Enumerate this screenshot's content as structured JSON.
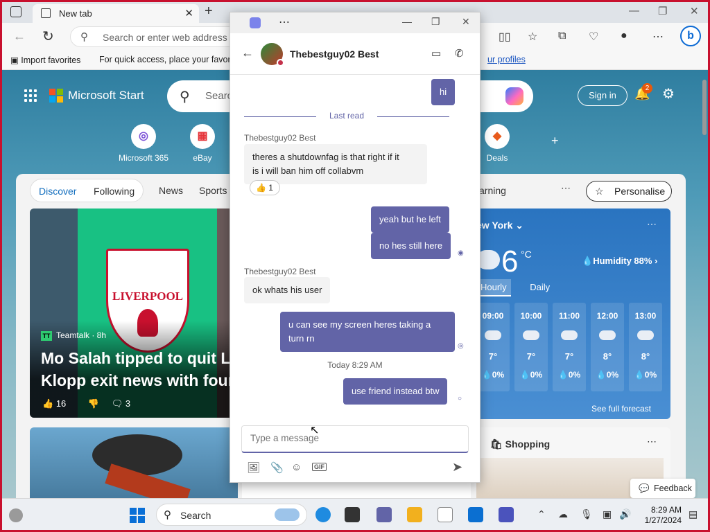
{
  "browser": {
    "tab_title": "New tab",
    "address_placeholder": "Search or enter web address",
    "favorites": {
      "import_label": "Import favorites",
      "quick_access_text": "For quick access, place your favorit",
      "profiles_link": "ur profiles"
    }
  },
  "msn": {
    "brand": "Microsoft Start",
    "search_placeholder": "Searc",
    "sign_in": "Sign in",
    "notification_count": "2",
    "quick_links": [
      {
        "label": "Microsoft 365"
      },
      {
        "label": "eBay"
      },
      {
        "label": "Deals"
      }
    ],
    "feed_tabs": [
      "Discover",
      "Following"
    ],
    "feed_nav": [
      "News",
      "Sports",
      "arning"
    ],
    "personalise": "Personalise",
    "news_card": {
      "source": "Teamtalk · 8h",
      "source_badge": "TT",
      "headline_line1": "Mo Salah tipped to quit L",
      "headline_line2": "Klopp exit news with four",
      "likes": "16",
      "comments": "3",
      "crest_text": "LIVERPOOL"
    },
    "weather": {
      "city": "ew York",
      "temp": "6",
      "unit": "°C",
      "humidity": "Humidity 88%",
      "toggle_hourly": "Hourly",
      "toggle_daily": "Daily",
      "hours": [
        {
          "time": "09:00",
          "temp": "7°",
          "precip": "0%"
        },
        {
          "time": "10:00",
          "temp": "7°",
          "precip": "0%"
        },
        {
          "time": "11:00",
          "temp": "7°",
          "precip": "0%"
        },
        {
          "time": "12:00",
          "temp": "8°",
          "precip": "0%"
        },
        {
          "time": "13:00",
          "temp": "8°",
          "precip": "0%"
        }
      ],
      "forecast_link": "See full forecast"
    },
    "shopping_label": "Shopping",
    "feedback": "Feedback"
  },
  "chat": {
    "contact_name": "Thebestguy02 Best",
    "last_read": "Last read",
    "messages": [
      {
        "from": "me",
        "text": "hi"
      },
      {
        "from": "them",
        "sender": "Thebestguy02 Best",
        "text_line1": "theres a shutdownfag is that right if it",
        "text_line2": "is i will ban him off collabvm",
        "reaction": "👍",
        "reaction_count": "1"
      },
      {
        "from": "me",
        "text": "yeah but he left"
      },
      {
        "from": "me",
        "text": "no hes still here"
      },
      {
        "from": "them",
        "sender": "Thebestguy02 Best",
        "text": "ok whats his user"
      },
      {
        "from": "me",
        "text_line1": "u can see my screen heres taking a",
        "text_line2": "turn rn"
      },
      {
        "timestamp": "Today 8:29 AM"
      },
      {
        "from": "me",
        "text": "use friend instead btw"
      }
    ],
    "compose_placeholder": "Type a message"
  },
  "taskbar": {
    "search_placeholder": "Search",
    "time": "8:29 AM",
    "date": "1/27/2024"
  },
  "colors": {
    "teams_accent": "#6264a7",
    "border_red": "#c8102e",
    "weather_blue": "#2a74c0"
  }
}
